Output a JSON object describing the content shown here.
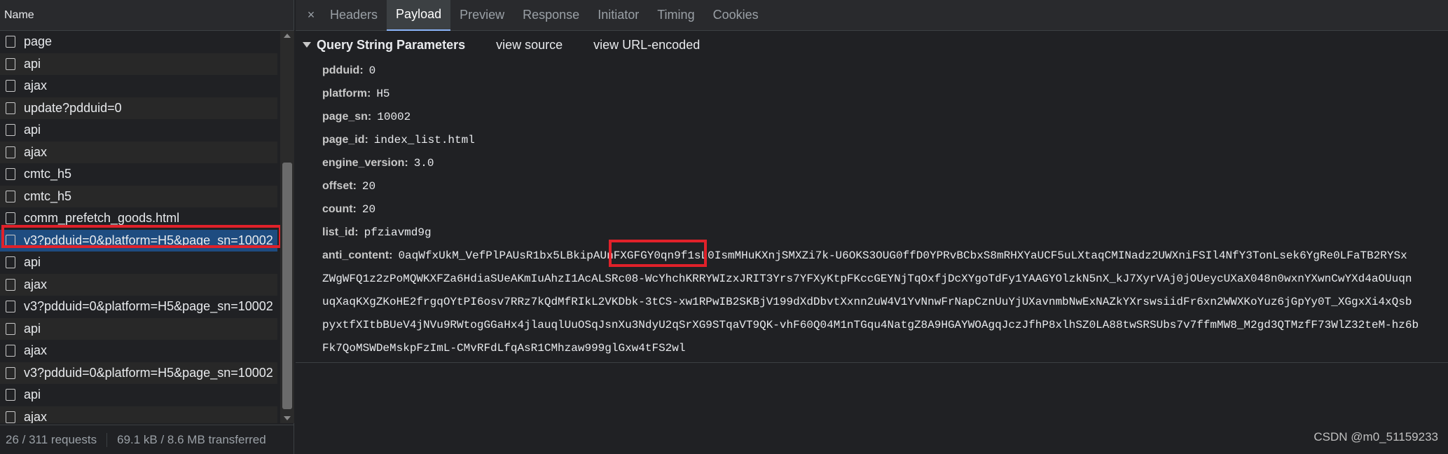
{
  "left_panel": {
    "header": "Name",
    "requests": [
      {
        "name": "page"
      },
      {
        "name": "api"
      },
      {
        "name": "ajax"
      },
      {
        "name": "update?pdduid=0"
      },
      {
        "name": "api"
      },
      {
        "name": "ajax"
      },
      {
        "name": "cmtc_h5"
      },
      {
        "name": "cmtc_h5"
      },
      {
        "name": "comm_prefetch_goods.html"
      },
      {
        "name": "v3?pdduid=0&platform=H5&page_sn=10002",
        "selected": true
      },
      {
        "name": "api"
      },
      {
        "name": "ajax"
      },
      {
        "name": "v3?pdduid=0&platform=H5&page_sn=10002"
      },
      {
        "name": "api"
      },
      {
        "name": "ajax"
      },
      {
        "name": "v3?pdduid=0&platform=H5&page_sn=10002"
      },
      {
        "name": "api"
      },
      {
        "name": "ajax"
      }
    ],
    "status": {
      "requests": "26 / 311 requests",
      "transferred": "69.1 kB / 8.6 MB transferred"
    }
  },
  "tabs": {
    "close": "×",
    "items": [
      "Headers",
      "Payload",
      "Preview",
      "Response",
      "Initiator",
      "Timing",
      "Cookies"
    ],
    "active": "Payload"
  },
  "payload": {
    "section_title": "Query String Parameters",
    "view_source": "view source",
    "view_url_encoded": "view URL-encoded",
    "params": [
      {
        "key": "pdduid",
        "value": "0"
      },
      {
        "key": "platform",
        "value": "H5"
      },
      {
        "key": "page_sn",
        "value": "10002"
      },
      {
        "key": "page_id",
        "value": "index_list.html"
      },
      {
        "key": "engine_version",
        "value": "3.0"
      },
      {
        "key": "offset",
        "value": "20"
      },
      {
        "key": "count",
        "value": "20"
      },
      {
        "key": "list_id",
        "value": "pfziavmd9g"
      },
      {
        "key": "anti_content",
        "value": "0aqWfxUkM_VefPlPAUsR1bx5LBkipAUnFXGFGY0qn9f1sL0IsmMHuKXnjSMXZi7k-U6OKS3OUG0ffD0YPRvBCbxS8mRHXYaUCF5uLXtaqCMINadz2UWXniFSIl4NfY3TonLsek6YgRe0LFaTB2RYSx"
      }
    ],
    "anti_content_continuation": [
      "ZWgWFQ1z2zPoMQWKXFZa6HdiaSUeAKmIuAhzI1AcALSRc08-WcYhchKRRYWIzxJRIT3Yrs7YFXyKtpFKccGEYNjTqOxfjDcXYgoTdFy1YAAGYOlzkN5nX_kJ7XyrVAj0jOUeycUXaX048n0wxnYXwnCwYXd4aOUuqn",
      "uqXaqKXgZKoHE2frgqOYtPI6osv7RRz7kQdMfRIkL2VKDbk-3tCS-xw1RPwIB2SKBjV199dXdDbvtXxnn2uW4V1YvNnwFrNapCznUuYjUXavnmbNwExNAZkYXrswsiidFr6xn2WWXKoYuz6jGpYy0T_XGgxXi4xQsb",
      "pyxtfXItbBUeV4jNVu9RWtogGGaHx4jlauqlUuOSqJsnXu3NdyU2qSrXG9STqaVT9QK-vhF60Q04M1nTGqu4NatgZ8A9HGAYWOAgqJczJfhP8xlhSZ0LA88twSRSUbs7v7ffmMW8_M2gd3QTMzfF73WlZ32teM-hz6b",
      "Fk7QoMSWDeMskpFzImL-CMvRFdLfqAsR1CMhzaw999glGxw4tFS2wl"
    ]
  },
  "watermark": "CSDN @m0_51159233"
}
